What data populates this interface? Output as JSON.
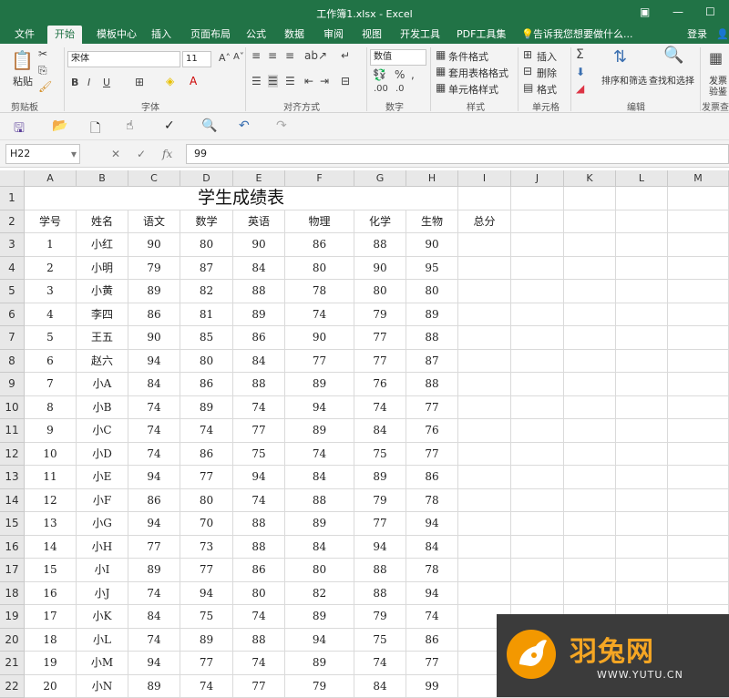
{
  "window": {
    "title": "工作簿1.xlsx - Excel",
    "login": "登录"
  },
  "tabs": [
    "文件",
    "开始",
    "模板中心",
    "插入",
    "页面布局",
    "公式",
    "数据",
    "审阅",
    "视图",
    "开发工具",
    "PDF工具集"
  ],
  "active_tab": "开始",
  "tell_me": "告诉我您想要做什么...",
  "ribbon": {
    "paste": "粘贴",
    "clipboard": "剪贴板",
    "font_name": "宋体",
    "font_size": "11",
    "font_group": "字体",
    "align_group": "对齐方式",
    "number_format": "数值",
    "number_group": "数字",
    "cond_format": "条件格式",
    "table_format": "套用表格格式",
    "cell_style": "单元格样式",
    "style_group": "样式",
    "insert": "插入",
    "delete": "删除",
    "format": "格式",
    "cell_group": "单元格",
    "sort_filter": "排序和筛选",
    "find_select": "查找和选择",
    "edit_group": "编辑",
    "invoice1": "发票",
    "invoice2": "验鉴",
    "invoice_group": "发票查验",
    "bold": "B",
    "italic": "I",
    "underline": "U"
  },
  "formula_bar": {
    "name_box": "H22",
    "value": "99",
    "fx": "fx"
  },
  "columns": [
    "A",
    "B",
    "C",
    "D",
    "E",
    "F",
    "G",
    "H",
    "I",
    "J",
    "K",
    "L",
    "M"
  ],
  "sheet": {
    "title": "学生成绩表",
    "headers": [
      "学号",
      "姓名",
      "语文",
      "数学",
      "英语",
      "物理",
      "化学",
      "生物",
      "总分"
    ],
    "rows": [
      [
        "1",
        "小红",
        "90",
        "80",
        "90",
        "86",
        "88",
        "90"
      ],
      [
        "2",
        "小明",
        "79",
        "87",
        "84",
        "80",
        "90",
        "95"
      ],
      [
        "3",
        "小黄",
        "89",
        "82",
        "88",
        "78",
        "80",
        "80"
      ],
      [
        "4",
        "李四",
        "86",
        "81",
        "89",
        "74",
        "79",
        "89"
      ],
      [
        "5",
        "王五",
        "90",
        "85",
        "86",
        "90",
        "77",
        "88"
      ],
      [
        "6",
        "赵六",
        "94",
        "80",
        "84",
        "77",
        "77",
        "87"
      ],
      [
        "7",
        "小A",
        "84",
        "86",
        "88",
        "89",
        "76",
        "88"
      ],
      [
        "8",
        "小B",
        "74",
        "89",
        "74",
        "94",
        "74",
        "77"
      ],
      [
        "9",
        "小C",
        "74",
        "74",
        "77",
        "89",
        "84",
        "76"
      ],
      [
        "10",
        "小D",
        "74",
        "86",
        "75",
        "74",
        "75",
        "77"
      ],
      [
        "11",
        "小E",
        "94",
        "77",
        "94",
        "84",
        "89",
        "86"
      ],
      [
        "12",
        "小F",
        "86",
        "80",
        "74",
        "88",
        "79",
        "78"
      ],
      [
        "13",
        "小G",
        "94",
        "70",
        "88",
        "89",
        "77",
        "94"
      ],
      [
        "14",
        "小H",
        "77",
        "73",
        "88",
        "84",
        "94",
        "84"
      ],
      [
        "15",
        "小I",
        "89",
        "77",
        "86",
        "80",
        "88",
        "78"
      ],
      [
        "16",
        "小J",
        "74",
        "94",
        "80",
        "82",
        "88",
        "94"
      ],
      [
        "17",
        "小K",
        "84",
        "75",
        "74",
        "89",
        "79",
        "74"
      ],
      [
        "18",
        "小L",
        "74",
        "89",
        "88",
        "94",
        "75",
        "86"
      ],
      [
        "19",
        "小M",
        "94",
        "77",
        "74",
        "89",
        "74",
        "77"
      ],
      [
        "20",
        "小N",
        "89",
        "74",
        "77",
        "79",
        "84",
        "99"
      ]
    ]
  },
  "watermark": {
    "brand": "羽兔网",
    "url": "WWW.YUTU.CN",
    "logo_color": "#f39800",
    "bg_color": "#3b3b3b"
  },
  "colors": {
    "excel_green": "#217346"
  }
}
